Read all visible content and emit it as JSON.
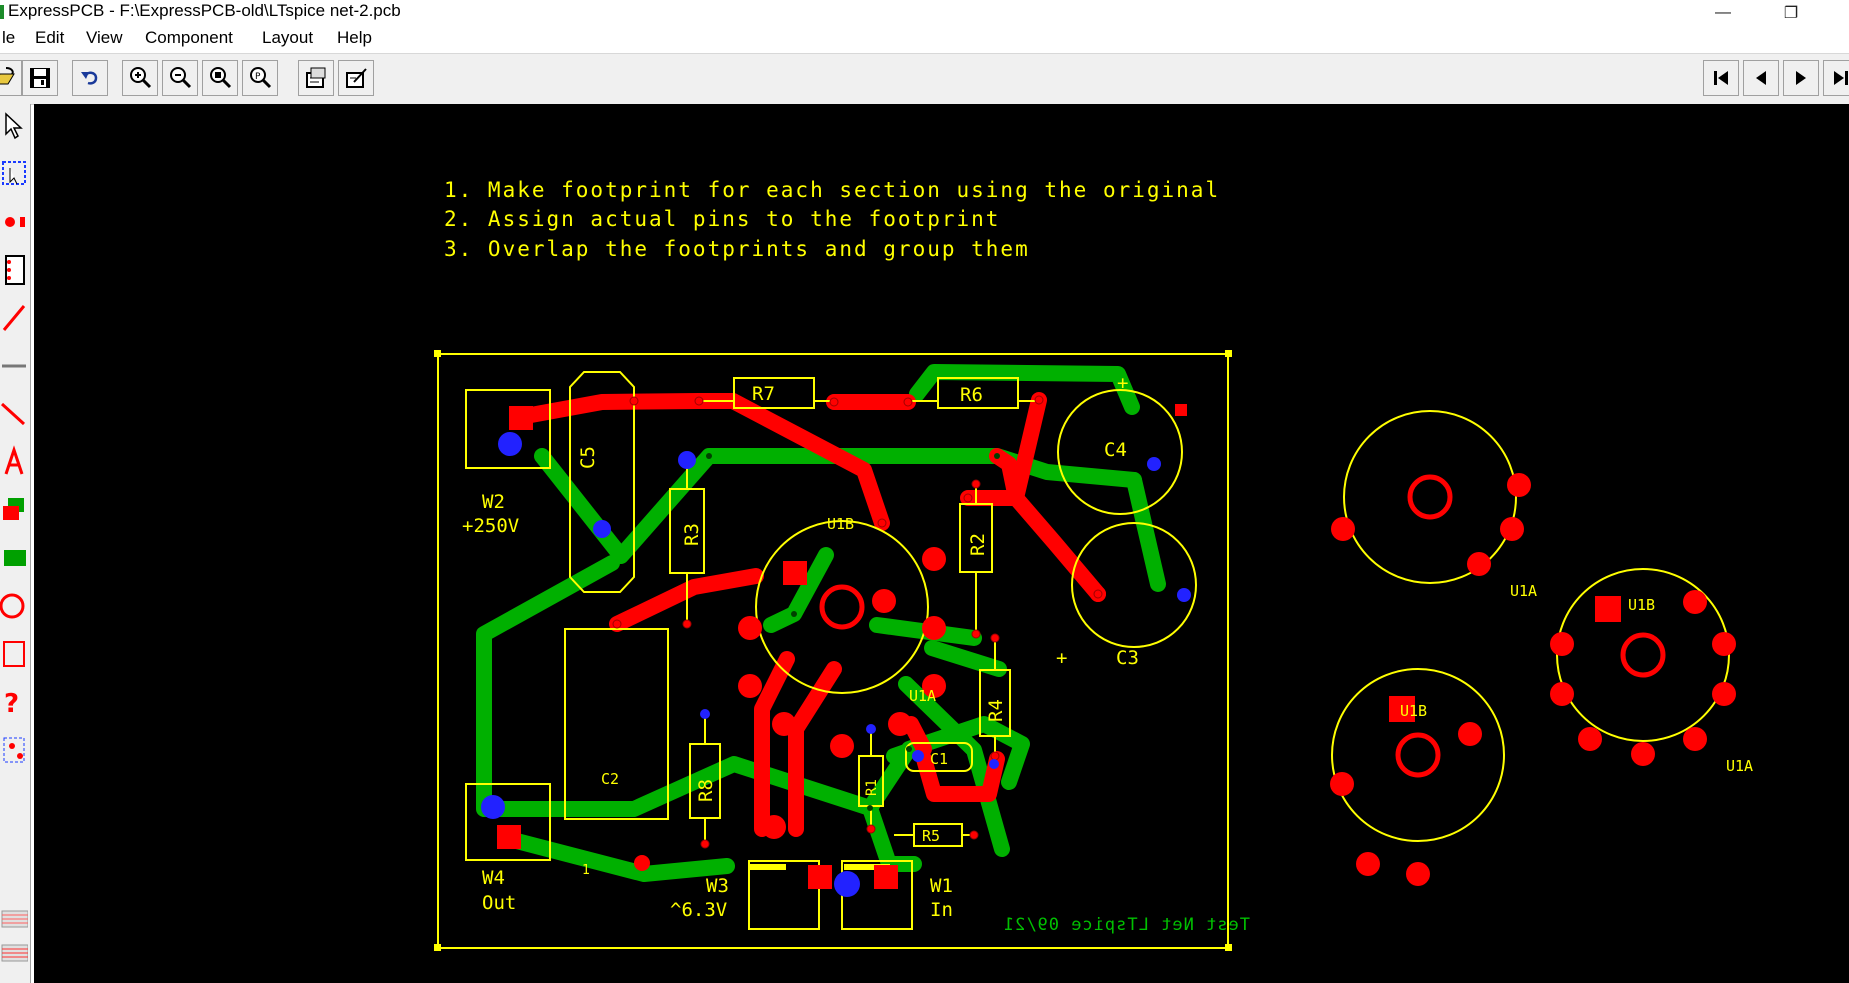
{
  "window": {
    "title": "ExpressPCB - F:\\ExpressPCB-old\\LTspice net-2.pcb",
    "minimize": "—",
    "restore": "❐"
  },
  "menu": [
    "le",
    "Edit",
    "View",
    "Component",
    "Layout",
    "Help"
  ],
  "toolbar": {
    "left": [
      "open-icon",
      "save-icon",
      "undo-icon",
      "zoom-in-icon",
      "zoom-out-icon",
      "zoom-fit-icon",
      "zoom-previous-icon",
      "properties-icon",
      "edit-properties-icon"
    ],
    "right": [
      "first-page-icon",
      "previous-page-icon",
      "next-page-icon",
      "last-page-icon"
    ]
  },
  "left_tools": [
    "select-arrow-icon",
    "select-area-icon",
    "pin-tool-icon",
    "component-tool-icon",
    "trace-tool-icon",
    "line-tool-icon",
    "diagonal-line-icon",
    "text-tool-icon",
    "layer-tool-icon",
    "fill-tool-icon",
    "circle-tool-icon",
    "dimension-tool-icon",
    "help-tool-icon",
    "group-tool-icon",
    "top-layer-icon",
    "bottom-layer-icon"
  ],
  "notes": [
    "1. Make footprint for each section using the original",
    "2. Assign actual pins to the footprint",
    "3. Overlap the footprints and group them"
  ],
  "labels": {
    "r7": "R7",
    "r6": "R6",
    "c4": "C4",
    "c5": "C5",
    "w2": "W2",
    "w2_voltage": "+250V",
    "r3": "R3",
    "u1b_main": "U1B",
    "r2": "R2",
    "c3": "C3",
    "c3_plus": "+",
    "c4_plus": "+",
    "u1a_main": "U1A",
    "r4": "R4",
    "c2": "C2",
    "c1": "C1",
    "r8": "R8",
    "r1": "R1",
    "r5": "R5",
    "w4": "W4",
    "w4_text": "Out",
    "w3": "W3",
    "w3_text": "^6.3V",
    "w1": "W1",
    "w1_text": "In",
    "c2_pin1": "1",
    "mirror_text": "Test Net LTspice 09/21",
    "fp1_label": "U1A",
    "fp2_label": "U1B",
    "fp2_label2": "U1A",
    "fp3_label": "U1B"
  },
  "colors": {
    "canvas": "#000000",
    "silkscreen": "#ffff00",
    "top_copper": "#00b000",
    "bottom_copper": "#ff0000",
    "via": "#0000ff",
    "bottom_text": "#00c000"
  }
}
